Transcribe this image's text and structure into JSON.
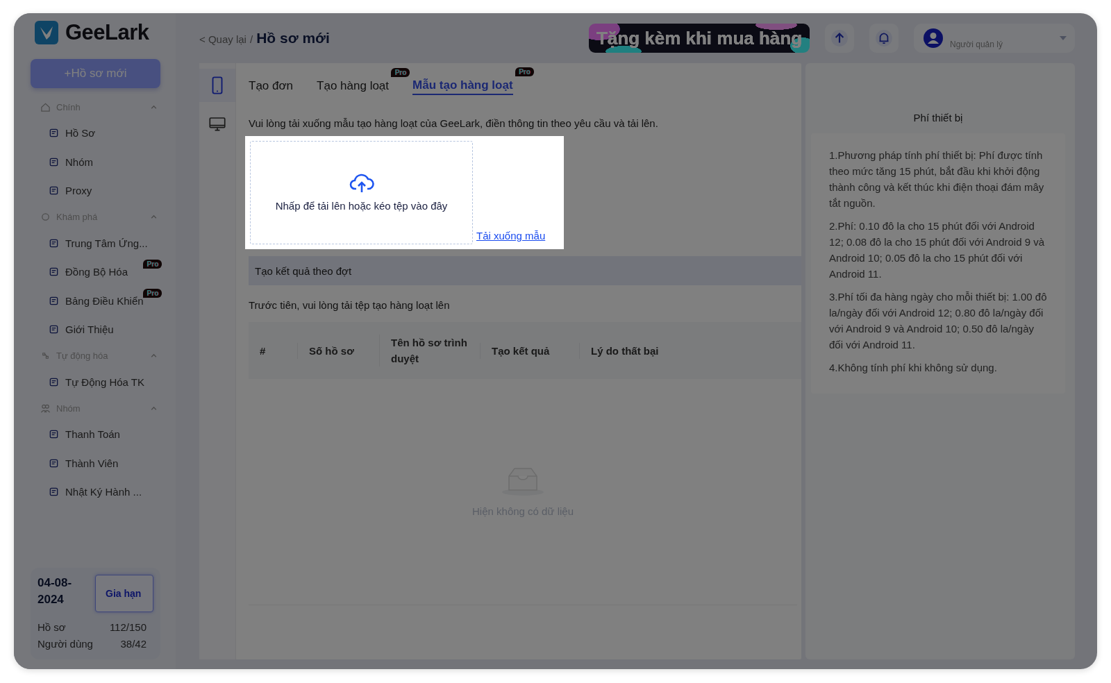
{
  "sidebar": {
    "logo": "GeeLark",
    "new_button": "+Hồ sơ mới",
    "sections": [
      {
        "title": "Chính",
        "expanded": true,
        "items": [
          {
            "label": "Hồ Sơ"
          },
          {
            "label": "Nhóm"
          },
          {
            "label": "Proxy"
          }
        ]
      },
      {
        "title": "Khám phá",
        "expanded": true,
        "items": [
          {
            "label": "Trung Tâm Ứng..."
          },
          {
            "label": "Đồng Bộ Hóa",
            "badge": "Pro"
          },
          {
            "label": "Bảng Điều Khiển",
            "badge": "Pro"
          },
          {
            "label": "Giới Thiệu"
          }
        ]
      },
      {
        "title": "Tự động hóa",
        "expanded": true,
        "items": [
          {
            "label": "Tự Động Hóa TK"
          }
        ]
      },
      {
        "title": "Nhóm",
        "expanded": true,
        "items": [
          {
            "label": "Thanh Toán"
          },
          {
            "label": "Thành Viên"
          },
          {
            "label": "Nhật Ký Hành ..."
          }
        ]
      }
    ],
    "plan": {
      "expiry": "04-08-2024",
      "renew_button": "Gia hạn",
      "rows": [
        {
          "label": "Hồ sơ",
          "value": "112/150"
        },
        {
          "label": "Người dùng",
          "value": "38/42"
        }
      ]
    }
  },
  "header": {
    "back_link": "< Quay lại",
    "separator": "/",
    "title": "Hồ sơ mới",
    "banner": "Tặng kèm khi mua hàng",
    "user_role": "Người quản lý"
  },
  "device_tabs": [
    {
      "selected": true
    },
    {
      "selected": false
    }
  ],
  "tabs": [
    {
      "label": "Tạo đơn",
      "selected": false
    },
    {
      "label": "Tạo hàng loạt",
      "badge": "Pro",
      "selected": false
    },
    {
      "label": "Mẫu tạo hàng loạt",
      "badge": "Pro",
      "selected": true
    }
  ],
  "instruction": "Vui lòng tải xuống mẫu tạo hàng loạt của GeeLark, điền thông tin theo yêu cầu và tải lên.",
  "upload": {
    "text": "Nhấp để tải lên hoặc kéo tệp vào đây",
    "download_link": "Tải xuống mẫu"
  },
  "results": {
    "title": "Tạo kết quả theo đợt",
    "note": "Trước tiên, vui lòng tải tệp tạo hàng loạt lên",
    "columns": [
      "#",
      "Số hồ sơ",
      "Tên hồ sơ trình duyệt",
      "Tạo kết quả",
      "Lý do thất bại"
    ],
    "empty": "Hiện không có dữ liệu"
  },
  "fees": {
    "title": "Phí thiết bị",
    "notes": [
      "1.Phương pháp tính phí thiết bị: Phí được tính theo mức tăng 15 phút, bắt đầu khi khởi động thành công và kết thúc khi điện thoại đám mây tắt nguồn.",
      "2.Phí: 0.10 đô la cho 15 phút đối với Android 12; 0.08 đô la cho 15 phút đối với Android 9 và Android 10; 0.05 đô la cho 15 phút đối với Android 11.",
      "3.Phí tối đa hàng ngày cho mỗi thiết bị: 1.00 đô la/ngày đối với Android 12; 0.80 đô la/ngày đối với Android 9 và Android 10; 0.50 đô la/ngày đối với Android 11.",
      "4.Không tính phí khi không sử dụng."
    ]
  }
}
